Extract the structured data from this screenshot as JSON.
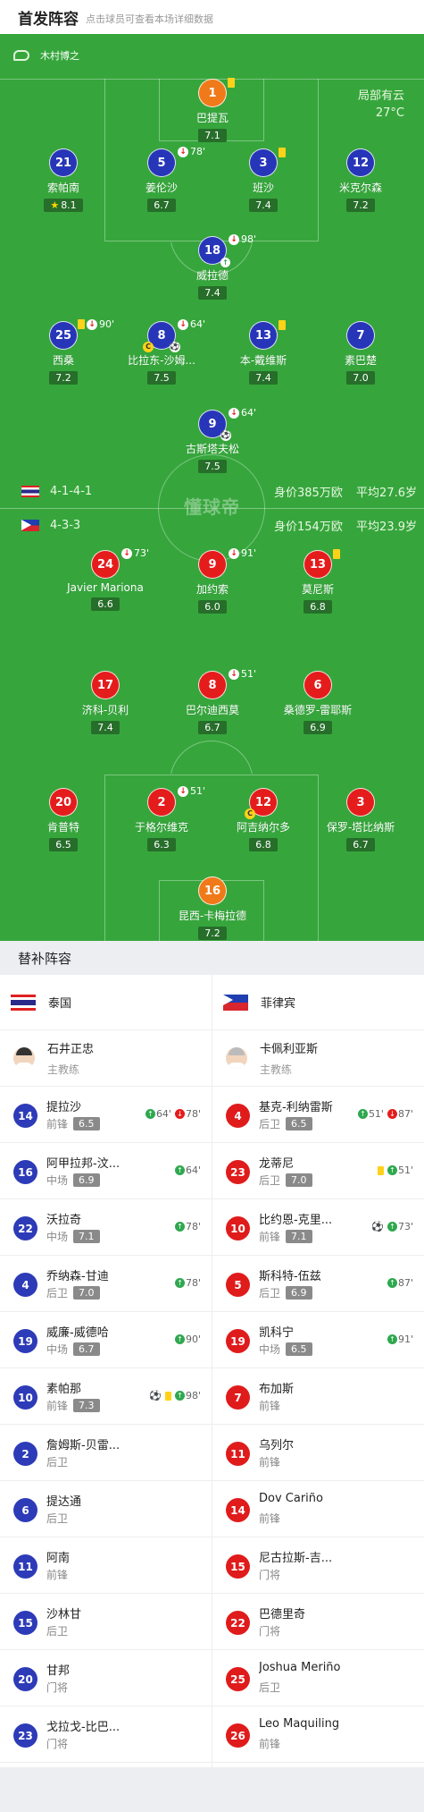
{
  "header": {
    "title": "首发阵容",
    "subtitle": "点击球员可查看本场详细数据"
  },
  "pitch": {
    "home_coach": "木村博之",
    "weather": {
      "desc": "局部有云",
      "temp": "27°C"
    },
    "watermark": "懂球帝",
    "home_team_bar": {
      "formation": "4-1-4-1",
      "value": "身价385万欧",
      "avg_age": "平均27.6岁"
    },
    "away_team_bar": {
      "formation": "4-3-3",
      "value": "身价154万欧",
      "avg_age": "平均23.9岁"
    },
    "home_players": [
      {
        "num": "1",
        "name": "巴提瓦",
        "rating": "7.1",
        "ev": ""
      },
      {
        "num": "21",
        "name": "索帕南",
        "rating": "8.1",
        "ev": ""
      },
      {
        "num": "5",
        "name": "姜伦沙",
        "rating": "6.7",
        "ev": "78'"
      },
      {
        "num": "3",
        "name": "班沙",
        "rating": "7.4",
        "ev": ""
      },
      {
        "num": "12",
        "name": "米克尔森",
        "rating": "7.2",
        "ev": ""
      },
      {
        "num": "18",
        "name": "威拉德",
        "rating": "7.4",
        "ev": "98'"
      },
      {
        "num": "25",
        "name": "西桑",
        "rating": "7.2",
        "ev": "90'"
      },
      {
        "num": "8",
        "name": "比拉东-沙姆...",
        "rating": "7.5",
        "ev": "64'"
      },
      {
        "num": "13",
        "name": "本-戴维斯",
        "rating": "7.4",
        "ev": ""
      },
      {
        "num": "7",
        "name": "素巴楚",
        "rating": "7.0",
        "ev": ""
      },
      {
        "num": "9",
        "name": "古斯塔夫松",
        "rating": "7.5",
        "ev": "64'"
      }
    ],
    "away_players": [
      {
        "num": "24",
        "name": "Javier Mariona",
        "rating": "6.6",
        "ev": "73'"
      },
      {
        "num": "9",
        "name": "加约索",
        "rating": "6.0",
        "ev": "91'"
      },
      {
        "num": "13",
        "name": "莫尼斯",
        "rating": "6.8",
        "ev": ""
      },
      {
        "num": "17",
        "name": "济科-贝利",
        "rating": "7.4",
        "ev": ""
      },
      {
        "num": "8",
        "name": "巴尔迪西莫",
        "rating": "6.7",
        "ev": "51'"
      },
      {
        "num": "6",
        "name": "桑德罗-雷耶斯",
        "rating": "6.9",
        "ev": ""
      },
      {
        "num": "20",
        "name": "肯普特",
        "rating": "6.5",
        "ev": ""
      },
      {
        "num": "2",
        "name": "于格尔维克",
        "rating": "6.3",
        "ev": "51'"
      },
      {
        "num": "12",
        "name": "阿吉纳尔多",
        "rating": "6.8",
        "ev": ""
      },
      {
        "num": "3",
        "name": "保罗-塔比纳斯",
        "rating": "6.7",
        "ev": ""
      },
      {
        "num": "16",
        "name": "昆西-卡梅拉德",
        "rating": "7.2",
        "ev": ""
      }
    ]
  },
  "subs": {
    "title": "替补阵容",
    "home": {
      "team": "泰国",
      "coach": {
        "name": "石井正忠",
        "role": "主教练"
      },
      "players": [
        {
          "num": "14",
          "name": "提拉沙",
          "pos": "前锋",
          "rating": "6.5",
          "ev1": "64'",
          "ev2": "78'"
        },
        {
          "num": "16",
          "name": "阿甲拉邦-汶...",
          "pos": "中场",
          "rating": "6.9",
          "ev1": "64'",
          "ev2": ""
        },
        {
          "num": "22",
          "name": "沃拉奇",
          "pos": "中场",
          "rating": "7.1",
          "ev1": "78'",
          "ev2": ""
        },
        {
          "num": "4",
          "name": "乔纳森-甘迪",
          "pos": "后卫",
          "rating": "7.0",
          "ev1": "78'",
          "ev2": ""
        },
        {
          "num": "19",
          "name": "威廉-威德哈",
          "pos": "中场",
          "rating": "6.7",
          "ev1": "90'",
          "ev2": ""
        },
        {
          "num": "10",
          "name": "素帕那",
          "pos": "前锋",
          "rating": "7.3",
          "ev1": "98'",
          "ev2": ""
        },
        {
          "num": "2",
          "name": "詹姆斯-贝雷...",
          "pos": "后卫",
          "rating": "",
          "ev1": "",
          "ev2": ""
        },
        {
          "num": "6",
          "name": "提达通",
          "pos": "后卫",
          "rating": "",
          "ev1": "",
          "ev2": ""
        },
        {
          "num": "11",
          "name": "阿南",
          "pos": "前锋",
          "rating": "",
          "ev1": "",
          "ev2": ""
        },
        {
          "num": "15",
          "name": "沙林甘",
          "pos": "后卫",
          "rating": "",
          "ev1": "",
          "ev2": ""
        },
        {
          "num": "20",
          "name": "甘邦",
          "pos": "门将",
          "rating": "",
          "ev1": "",
          "ev2": ""
        },
        {
          "num": "23",
          "name": "戈拉戈-比巴...",
          "pos": "门将",
          "rating": "",
          "ev1": "",
          "ev2": ""
        }
      ]
    },
    "away": {
      "team": "菲律宾",
      "coach": {
        "name": "卡佩利亚斯",
        "role": "主教练"
      },
      "players": [
        {
          "num": "4",
          "name": "基克-利纳雷斯",
          "pos": "后卫",
          "rating": "6.5",
          "ev1": "51'",
          "ev2": "87'"
        },
        {
          "num": "23",
          "name": "龙蒂尼",
          "pos": "后卫",
          "rating": "7.0",
          "ev1": "51'",
          "ev2": ""
        },
        {
          "num": "10",
          "name": "比约恩-克里...",
          "pos": "前锋",
          "rating": "7.1",
          "ev1": "73'",
          "ev2": ""
        },
        {
          "num": "5",
          "name": "斯科特-伍兹",
          "pos": "后卫",
          "rating": "6.9",
          "ev1": "87'",
          "ev2": ""
        },
        {
          "num": "19",
          "name": "凯科宁",
          "pos": "中场",
          "rating": "6.5",
          "ev1": "91'",
          "ev2": ""
        },
        {
          "num": "7",
          "name": "布加斯",
          "pos": "前锋",
          "rating": "",
          "ev1": "",
          "ev2": ""
        },
        {
          "num": "11",
          "name": "乌列尔",
          "pos": "前锋",
          "rating": "",
          "ev1": "",
          "ev2": ""
        },
        {
          "num": "14",
          "name": "Dov Cariño",
          "pos": "前锋",
          "rating": "",
          "ev1": "",
          "ev2": ""
        },
        {
          "num": "15",
          "name": "尼古拉斯-吉...",
          "pos": "门将",
          "rating": "",
          "ev1": "",
          "ev2": ""
        },
        {
          "num": "22",
          "name": "巴德里奇",
          "pos": "门将",
          "rating": "",
          "ev1": "",
          "ev2": ""
        },
        {
          "num": "25",
          "name": "Joshua Meriño",
          "pos": "后卫",
          "rating": "",
          "ev1": "",
          "ev2": ""
        },
        {
          "num": "26",
          "name": "Leo Maquiling",
          "pos": "前锋",
          "rating": "",
          "ev1": "",
          "ev2": ""
        }
      ]
    }
  }
}
